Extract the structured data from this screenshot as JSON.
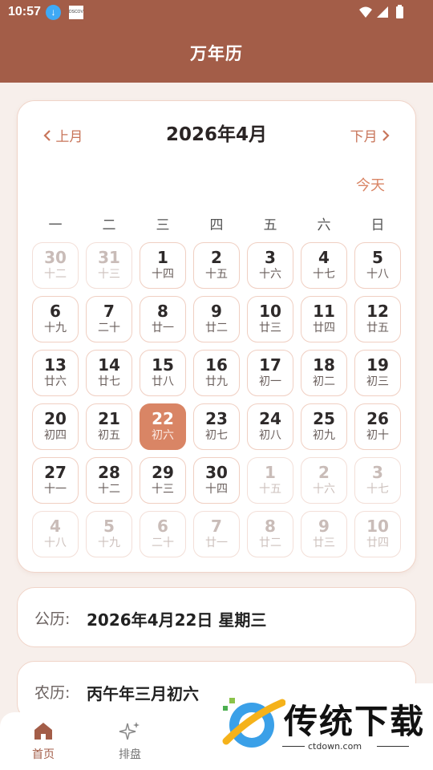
{
  "status_bar": {
    "time": "10:57",
    "app_icon_text": "DSCOVR"
  },
  "header": {
    "title": "万年历"
  },
  "calendar": {
    "prev_label": "上月",
    "next_label": "下月",
    "month_title": "2026年4月",
    "today_label": "今天",
    "weekdays": [
      "一",
      "二",
      "三",
      "四",
      "五",
      "六",
      "日"
    ],
    "days": [
      {
        "num": "30",
        "lunar": "十二",
        "other": true
      },
      {
        "num": "31",
        "lunar": "十三",
        "other": true
      },
      {
        "num": "1",
        "lunar": "十四"
      },
      {
        "num": "2",
        "lunar": "十五"
      },
      {
        "num": "3",
        "lunar": "十六"
      },
      {
        "num": "4",
        "lunar": "十七"
      },
      {
        "num": "5",
        "lunar": "十八"
      },
      {
        "num": "6",
        "lunar": "十九"
      },
      {
        "num": "7",
        "lunar": "二十"
      },
      {
        "num": "8",
        "lunar": "廿一"
      },
      {
        "num": "9",
        "lunar": "廿二"
      },
      {
        "num": "10",
        "lunar": "廿三"
      },
      {
        "num": "11",
        "lunar": "廿四"
      },
      {
        "num": "12",
        "lunar": "廿五"
      },
      {
        "num": "13",
        "lunar": "廿六"
      },
      {
        "num": "14",
        "lunar": "廿七"
      },
      {
        "num": "15",
        "lunar": "廿八"
      },
      {
        "num": "16",
        "lunar": "廿九"
      },
      {
        "num": "17",
        "lunar": "初一"
      },
      {
        "num": "18",
        "lunar": "初二"
      },
      {
        "num": "19",
        "lunar": "初三"
      },
      {
        "num": "20",
        "lunar": "初四"
      },
      {
        "num": "21",
        "lunar": "初五"
      },
      {
        "num": "22",
        "lunar": "初六",
        "selected": true
      },
      {
        "num": "23",
        "lunar": "初七"
      },
      {
        "num": "24",
        "lunar": "初八"
      },
      {
        "num": "25",
        "lunar": "初九"
      },
      {
        "num": "26",
        "lunar": "初十"
      },
      {
        "num": "27",
        "lunar": "十一"
      },
      {
        "num": "28",
        "lunar": "十二"
      },
      {
        "num": "29",
        "lunar": "十三"
      },
      {
        "num": "30",
        "lunar": "十四"
      },
      {
        "num": "1",
        "lunar": "十五",
        "other": true
      },
      {
        "num": "2",
        "lunar": "十六",
        "other": true
      },
      {
        "num": "3",
        "lunar": "十七",
        "other": true
      },
      {
        "num": "4",
        "lunar": "十八",
        "other": true
      },
      {
        "num": "5",
        "lunar": "十九",
        "other": true
      },
      {
        "num": "6",
        "lunar": "二十",
        "other": true
      },
      {
        "num": "7",
        "lunar": "廿一",
        "other": true
      },
      {
        "num": "8",
        "lunar": "廿二",
        "other": true
      },
      {
        "num": "9",
        "lunar": "廿三",
        "other": true
      },
      {
        "num": "10",
        "lunar": "廿四",
        "other": true
      }
    ]
  },
  "solar_info": {
    "label": "公历:",
    "value": "2026年4月22日 星期三"
  },
  "lunar_info": {
    "label": "农历:",
    "value": "丙午年三月初六"
  },
  "bottom_nav": {
    "tabs": [
      {
        "label": "首页",
        "icon": "home-icon",
        "active": true
      },
      {
        "label": "排盘",
        "icon": "sparkle-icon"
      }
    ]
  },
  "watermark": {
    "text": "传统下载",
    "url": "ctdown.com"
  },
  "colors": {
    "brand": "#a35d48",
    "accent": "#d98565",
    "background": "#f7efeb"
  }
}
